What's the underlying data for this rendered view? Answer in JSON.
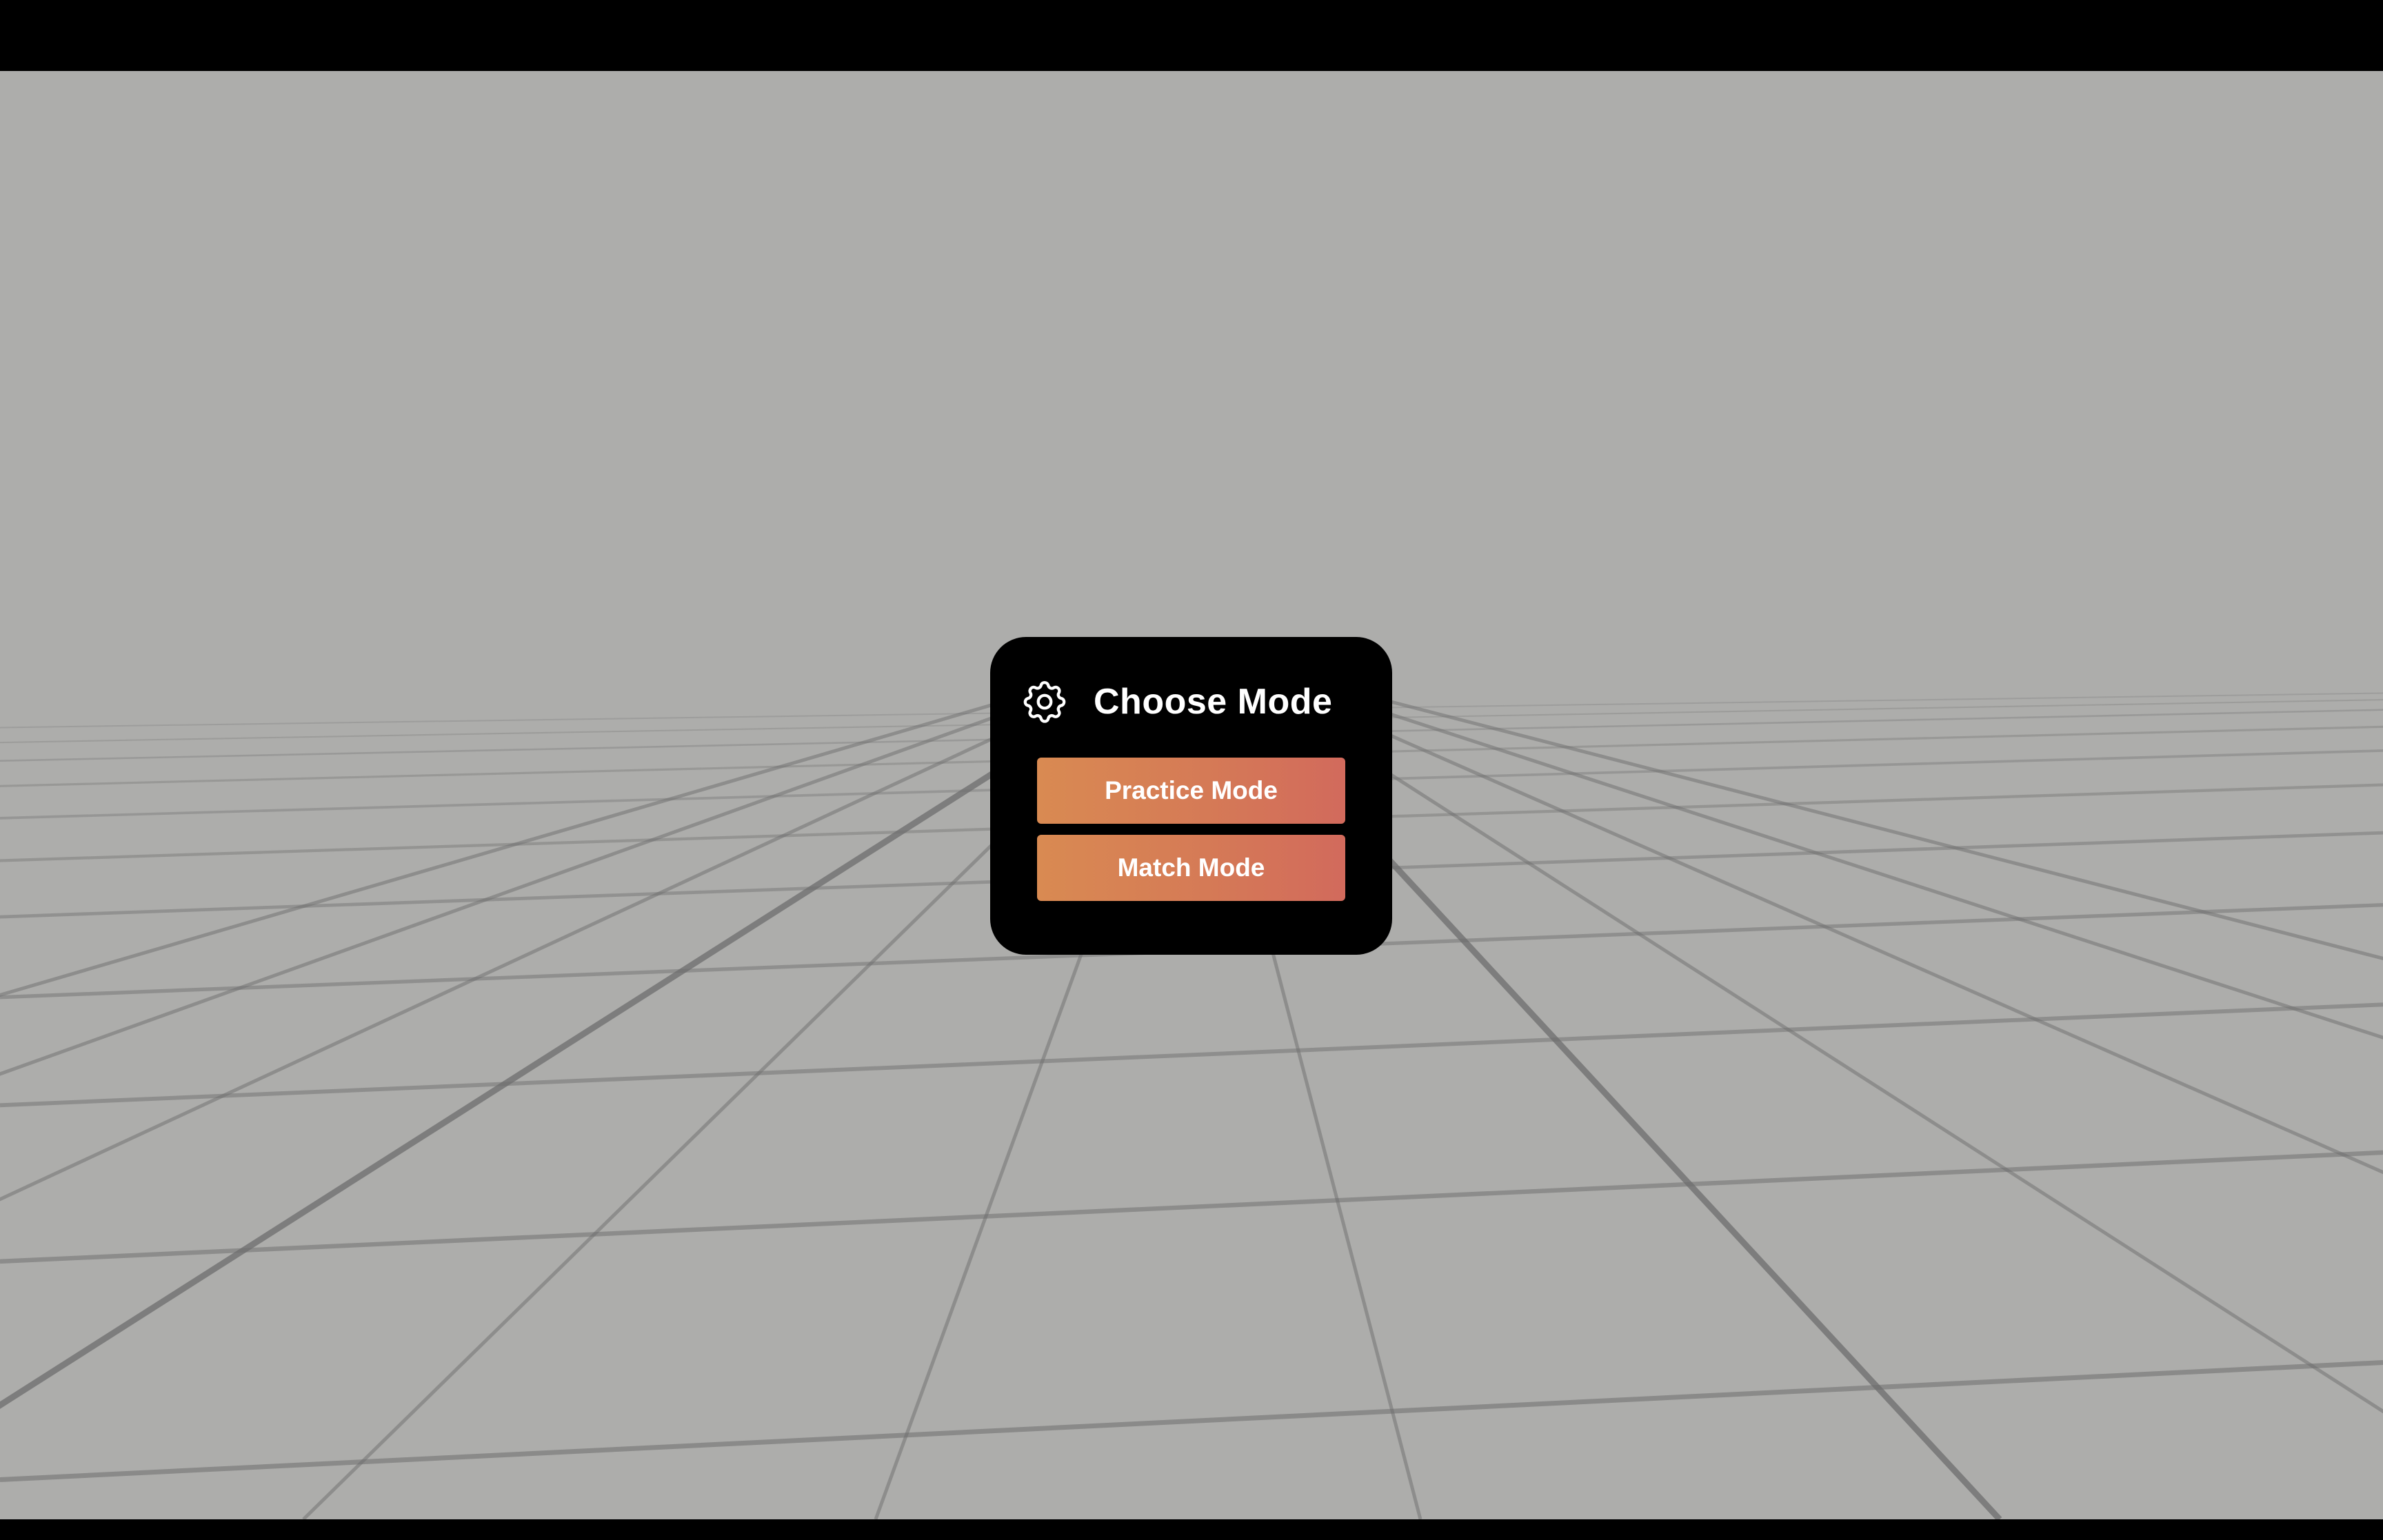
{
  "dialog": {
    "title": "Choose Mode",
    "icon": "gear-icon",
    "buttons": {
      "practice_label": "Practice Mode",
      "match_label": "Match Mode"
    }
  },
  "colors": {
    "background": "#adadab",
    "grid_line": "#6e6e6e",
    "dialog_bg": "#000000",
    "button_gradient_start": "#d98a52",
    "button_gradient_end": "#d26a5c",
    "text": "#ffffff"
  }
}
